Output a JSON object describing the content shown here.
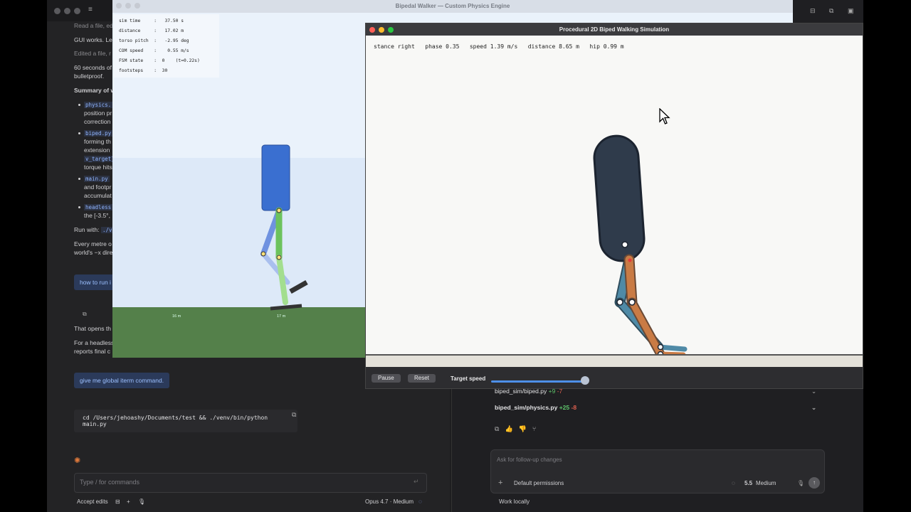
{
  "chat": {
    "lines": [
      "Read a file, ed",
      "GUI works. Le",
      "Edited a file, r",
      "60 seconds of",
      "bulletproof.",
      "Summary of w",
      "position pr",
      "correction",
      "forming th",
      "extension",
      "torque hits",
      "and footpr",
      "accumulat",
      "the [-3.5°,",
      "Run with:",
      "Every metre o",
      "world's −x dire",
      "That opens th",
      "For a headless",
      "reports final c"
    ],
    "code_tokens": [
      "physics.",
      "biped.py",
      "v_target)",
      "main.py",
      "headless",
      "./v"
    ],
    "pill1": "how to run i",
    "pill2": "give me global iterm command.",
    "command": "cd /Users/jehoashy/Documents/test && ./venv/bin/python main.py",
    "input_placeholder": "Type / for commands",
    "accept_edits": "Accept edits",
    "model": "Opus 4.7 · Medium"
  },
  "ide": {
    "files": [
      {
        "name": "biped_sim/biped.py",
        "add": "+9",
        "del": "-7"
      },
      {
        "name": "biped_sim/physics.py",
        "add": "+25",
        "del": "-8"
      }
    ],
    "ask_placeholder": "Ask for follow-up changes",
    "permissions": "Default permissions",
    "model_version": "5.5",
    "model_effort": "Medium",
    "work_locally": "Work locally"
  },
  "walker": {
    "title": "Bipedal Walker — Custom Physics Engine",
    "hud": [
      "sim time     :   37.50 s",
      "distance     :   17.02 m",
      "torso pitch  :   -2.95 deg",
      "COM speed    :    0.55 m/s",
      "FSM state    :  0    (t=0.22s)",
      "footsteps    :  30"
    ],
    "tick_labels": [
      "16 m",
      "17 m"
    ]
  },
  "procedural": {
    "title": "Procedural 2D Biped Walking Simulation",
    "status": "stance right   phase 0.35   speed 1.39 m/s   distance 8.65 m   hip 0.99 m",
    "pause_label": "Pause",
    "reset_label": "Reset",
    "target_speed_label": "Target speed",
    "target_speed_value": 0.97
  }
}
